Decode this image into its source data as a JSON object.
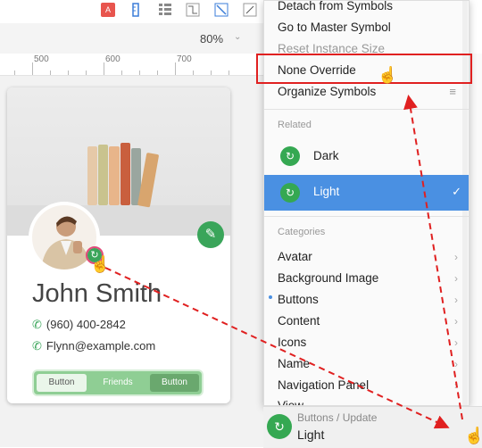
{
  "zoom": {
    "value": "80%"
  },
  "ruler": {
    "ticks": [
      "500",
      "600",
      "700"
    ]
  },
  "card": {
    "name": "John Smith",
    "phone": "(960) 400-2842",
    "email": "Flynn@example.com",
    "segments": [
      "Button",
      "Friends",
      "Button"
    ]
  },
  "menu": {
    "items_top": [
      {
        "label": "Detach from Symbols",
        "disabled": false
      },
      {
        "label": "Go to Master Symbol",
        "disabled": false
      },
      {
        "label": "Reset Instance Size",
        "disabled": true
      },
      {
        "label": "None Override",
        "disabled": false
      },
      {
        "label": "Organize Symbols",
        "disabled": false
      }
    ],
    "related_header": "Related",
    "related": [
      "Dark",
      "Light"
    ],
    "categories_header": "Categories",
    "categories": [
      "Avatar",
      "Background Image",
      "Buttons",
      "Content",
      "Icons",
      "Name",
      "Navigation Panel",
      "View"
    ]
  },
  "bottom": {
    "path": "Buttons / Update",
    "value": "Light"
  },
  "colors": {
    "accent_green": "#3aa55a",
    "selection_blue": "#4a90e2",
    "highlight_red": "#e02020"
  }
}
